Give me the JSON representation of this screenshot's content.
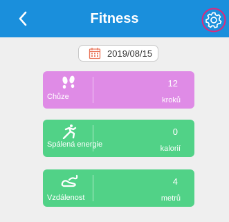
{
  "header": {
    "title": "Fitness",
    "accent": "#1a8fdc",
    "back_icon": "chevron-left-icon",
    "settings_icon": "gear-icon",
    "settings_highlight": "#e0287a"
  },
  "date": {
    "icon": "calendar-icon",
    "value": "2019/08/15"
  },
  "cards": [
    {
      "icon": "footprints-icon",
      "label": "Chůze",
      "value": "12",
      "unit": "kroků",
      "color": "#df8be6"
    },
    {
      "icon": "running-icon",
      "label": "Spálená energie",
      "value": "0",
      "unit": "kalorií",
      "color": "#51d287"
    },
    {
      "icon": "distance-shoe-icon",
      "label": "Vzdálenost",
      "value": "4",
      "unit": "metrů",
      "color": "#51d287"
    }
  ]
}
